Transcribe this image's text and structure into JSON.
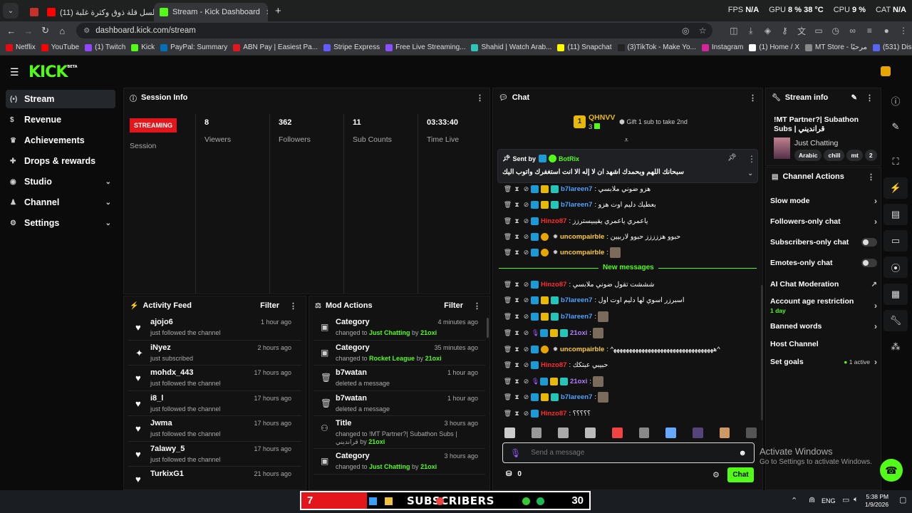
{
  "browser": {
    "tabs": [
      {
        "label": "(11) مسلسل قلة ذوق وكثرة غلبة"
      },
      {
        "label": "Stream - Kick Dashboard"
      }
    ],
    "new_tab": "+",
    "url": "dashboard.kick.com/stream",
    "bookmarks": [
      "Netflix",
      "YouTube",
      "(1) Twitch",
      "Kick",
      "PayPal: Summary",
      "ABN Pay | Easiest Pa...",
      "Stripe Express",
      "Free Live Streaming...",
      "Shahid | Watch Arab...",
      "(11) Snapchat",
      "(3)TikTok - Make Yo...",
      "Instagram",
      "(1) Home / X",
      "MT Store - مرحبًا",
      "(531) Discord | Frien..."
    ],
    "hud": {
      "fps_label": "FPS",
      "fps": "N/A",
      "gpu_label": "GPU",
      "gpu": "8 %",
      "gpu_temp": "38 °C",
      "cpu_label": "CPU",
      "cpu": "9 %",
      "cat_label": "CAT",
      "cat": "N/A"
    }
  },
  "app": {
    "logo": "KICK",
    "logo_badge": "BETA"
  },
  "sidebar": {
    "items": [
      {
        "label": "Stream",
        "icon": "broadcast-icon"
      },
      {
        "label": "Revenue",
        "icon": "dollar-icon"
      },
      {
        "label": "Achievements",
        "icon": "trophy-icon"
      },
      {
        "label": "Drops & rewards",
        "icon": "gift-icon"
      },
      {
        "label": "Studio",
        "icon": "studio-icon"
      },
      {
        "label": "Channel",
        "icon": "user-icon"
      },
      {
        "label": "Settings",
        "icon": "gear-icon"
      }
    ]
  },
  "session": {
    "title": "Session Info",
    "status": "STREAMING",
    "status_label": "Session",
    "stats": [
      {
        "value": "8",
        "label": "Viewers"
      },
      {
        "value": "362",
        "label": "Followers"
      },
      {
        "value": "11",
        "label": "Sub Counts"
      },
      {
        "value": "03:33:40",
        "label": "Time Live"
      }
    ]
  },
  "activity": {
    "title": "Activity Feed",
    "filter": "Filter",
    "items": [
      {
        "name": "ajojo6",
        "desc": "just followed the channel",
        "time": "1 hour ago",
        "icon": "heart-icon"
      },
      {
        "name": "iNyez",
        "desc": "just subscribed",
        "time": "2 hours ago",
        "icon": "sparkle-icon"
      },
      {
        "name": "mohdx_443",
        "desc": "just followed the channel",
        "time": "17 hours ago",
        "icon": "heart-icon"
      },
      {
        "name": "i8_l",
        "desc": "just followed the channel",
        "time": "17 hours ago",
        "icon": "heart-icon"
      },
      {
        "name": "Jwma",
        "desc": "just followed the channel",
        "time": "17 hours ago",
        "icon": "heart-icon"
      },
      {
        "name": "7alawy_5",
        "desc": "just followed the channel",
        "time": "17 hours ago",
        "icon": "heart-icon"
      },
      {
        "name": "TurkixG1",
        "desc": "",
        "time": "21 hours ago",
        "icon": "heart-icon"
      }
    ]
  },
  "mod": {
    "title": "Mod Actions",
    "filter": "Filter",
    "items": [
      {
        "name": "Category",
        "pre": "changed to ",
        "hl": "Just Chatting",
        "post": " by ",
        "by": "21oxi",
        "time": "4 minutes ago"
      },
      {
        "name": "Category",
        "pre": "changed to ",
        "hl": "Rocket League",
        "post": " by ",
        "by": "21oxi",
        "time": "35 minutes ago"
      },
      {
        "name": "b7watan",
        "pre": "deleted a message",
        "hl": "",
        "post": "",
        "by": "",
        "time": "1 hour ago"
      },
      {
        "name": "b7watan",
        "pre": "deleted a message",
        "hl": "",
        "post": "",
        "by": "",
        "time": "1 hour ago"
      },
      {
        "name": "Title",
        "pre": "changed to !MT Partner?| Subathon Subs | قرانديني by ",
        "hl": "",
        "post": "",
        "by": "21oxi",
        "time": "3 hours ago"
      },
      {
        "name": "Category",
        "pre": "changed to ",
        "hl": "Just Chatting",
        "post": " by ",
        "by": "21oxi",
        "time": "3 hours ago"
      }
    ]
  },
  "chat": {
    "title": "Chat",
    "top_gifter": "QHNVV",
    "top_gifter_count": "3",
    "top_rank": "1",
    "gift_text": "Gift 1 sub to take 2nd",
    "pinned_label": "Sent by",
    "pinned_user": "BotRix",
    "pinned_msg": "سبحانك اللهم وبحمدك اشهد ان لا إله الا انت استغفرك واتوب اليك",
    "new_messages": "New messages",
    "messages": [
      {
        "user": "b7lareen7",
        "color": "#4da3ff",
        "text": ": هزو ضوني ملابسي"
      },
      {
        "user": "b7lareen7",
        "color": "#4da3ff",
        "text": ": بعطيك دليم اوت هزو"
      },
      {
        "user": "Hinzo87",
        "color": "#ff2b2b",
        "text": ": ياعمري ياعمري يقيبيسترزز"
      },
      {
        "user": "uncompairble",
        "color": "#ffcc33",
        "text": ": حبوو هززززز حبوو لاربيين"
      },
      {
        "user": "uncompairble",
        "color": "#ffcc33",
        "text": ": "
      },
      {
        "user": "Hinzo87",
        "color": "#ff2b2b",
        "text": ": شششت تقول ضوني ملابسي"
      },
      {
        "user": "b7lareen7",
        "color": "#4da3ff",
        "text": ": اسبرزر اسوي لها دليم اوت اول"
      },
      {
        "user": "b7lareen7",
        "color": "#4da3ff",
        "text": ": "
      },
      {
        "user": "21oxi",
        "color": "#b57bff",
        "text": ": "
      },
      {
        "user": "uncompairble",
        "color": "#ffcc33",
        "text": ": ^ﻫﻬﻬﻬﻬﻬﻬﻬﻬﻬﻬﻬﻬﻬﻬﻬﻬﻬﻬﻬﻬﻬﻬﻬﻬﻬﻬﻬﻬﻬﻬﻬﻬ^"
      },
      {
        "user": "Hinzo87",
        "color": "#ff2b2b",
        "text": ": حبيبي عبتكك"
      },
      {
        "user": "21oxi",
        "color": "#b57bff",
        "text": ": "
      },
      {
        "user": "b7lareen7",
        "color": "#4da3ff",
        "text": ": "
      },
      {
        "user": "Hinzo87",
        "color": "#ff2b2b",
        "text": ": ؟؟؟؟؟"
      }
    ],
    "input_placeholder": "Send a message",
    "points": "0",
    "send": "Chat"
  },
  "streaminfo": {
    "title": "Stream info",
    "stream_title": "!MT Partner?| Subathon Subs | قرانديني",
    "category": "Just Chatting",
    "tags": [
      "Arabic",
      "chill",
      "mt",
      "2"
    ]
  },
  "actions": {
    "title": "Channel Actions",
    "items": [
      {
        "label": "Slow mode",
        "kind": "chev"
      },
      {
        "label": "Followers-only chat",
        "kind": "chev"
      },
      {
        "label": "Subscribers-only chat",
        "kind": "toggle"
      },
      {
        "label": "Emotes-only chat",
        "kind": "toggle"
      },
      {
        "label": "AI Chat Moderation",
        "kind": "ext"
      },
      {
        "label": "Account age restriction",
        "sub": "1 day",
        "kind": "chev"
      },
      {
        "label": "Banned words",
        "kind": "chev"
      },
      {
        "label": "Host Channel",
        "kind": "none"
      },
      {
        "label": "Set goals",
        "sub2": "1 active",
        "kind": "chev"
      }
    ]
  },
  "windows": {
    "activate": "Activate Windows",
    "activate_sub": "Go to Settings to activate Windows."
  },
  "taskbar": {
    "left_num": "7",
    "subscribers": "SUBSCRIBERS",
    "right_num": "30",
    "lang": "ENG",
    "time": "5:38 PM",
    "date": "1/9/2026"
  },
  "colors": {
    "kick_green": "#53fc18",
    "live_red": "#e2161b",
    "panel": "#121212"
  }
}
